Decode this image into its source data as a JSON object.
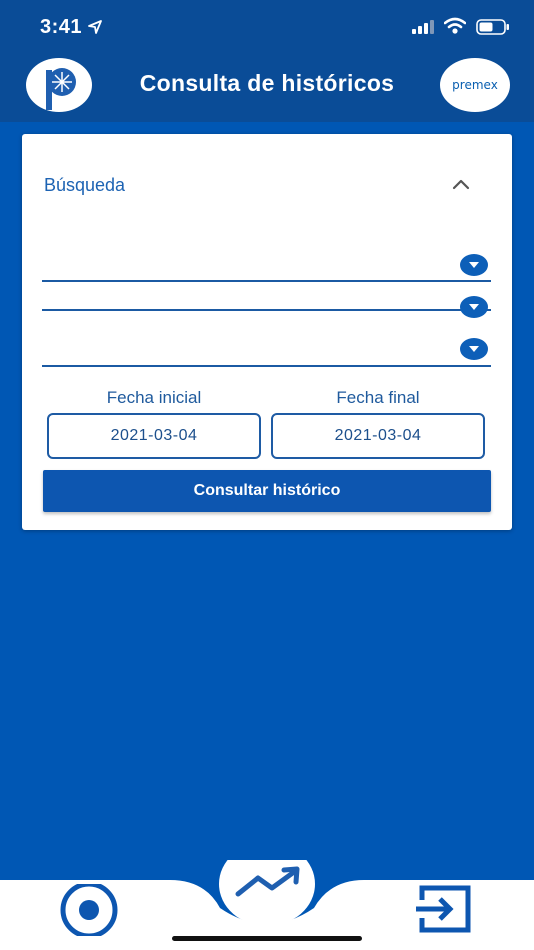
{
  "status_bar": {
    "time": "3:41"
  },
  "header": {
    "title": "Consulta de históricos",
    "brand_right": "premex"
  },
  "search": {
    "title": "Búsqueda",
    "dropdowns": [
      {
        "value": ""
      },
      {
        "value": ""
      },
      {
        "value": ""
      }
    ],
    "start_date_label": "Fecha inicial",
    "end_date_label": "Fecha final",
    "start_date": "2021-03-04",
    "end_date": "2021-03-04",
    "submit_label": "Consultar histórico"
  },
  "nav": {
    "items": [
      {
        "icon": "record-icon"
      },
      {
        "icon": "trend-icon",
        "active": true
      },
      {
        "icon": "exit-icon"
      }
    ]
  },
  "colors": {
    "background": "#0057b4",
    "header": "#0a4c97",
    "accent": "#0d56b0",
    "card": "#ffffff"
  }
}
